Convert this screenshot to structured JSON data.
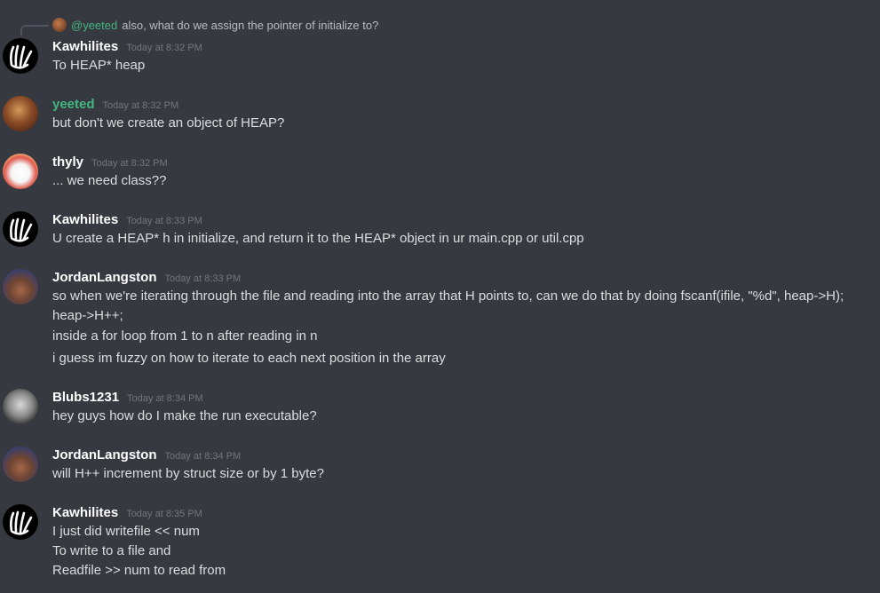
{
  "reply": {
    "name": "@yeeted",
    "text": "also, what do we assign the pointer of initialize to?"
  },
  "messages": [
    {
      "author": "Kawhilites",
      "time": "Today at 8:32 PM",
      "lines": [
        "To HEAP* heap"
      ]
    },
    {
      "author": "yeeted",
      "time": "Today at 8:32 PM",
      "lines": [
        "but don't we create an object of HEAP?"
      ]
    },
    {
      "author": "thyly",
      "time": "Today at 8:32 PM",
      "lines": [
        "... we need class??"
      ]
    },
    {
      "author": "Kawhilites",
      "time": "Today at 8:33 PM",
      "lines": [
        "U create a HEAP* h in initialize, and return it to the HEAP* object in ur main.cpp or util.cpp"
      ]
    },
    {
      "author": "JordanLangston",
      "time": "Today at 8:33 PM",
      "lines": [
        "so when we're iterating through the file and reading into the array that H points to, can we do that by doing fscanf(ifile, \"%d\", heap->H);",
        "heap->H++;",
        "inside a for loop from 1 to n after reading in n",
        "i guess im fuzzy on how to iterate to each next position in the array"
      ]
    },
    {
      "author": "Blubs1231",
      "time": "Today at 8:34 PM",
      "lines": [
        "hey guys how do I make the run executable?"
      ]
    },
    {
      "author": "JordanLangston",
      "time": "Today at 8:34 PM",
      "lines": [
        "will H++ increment by struct size or by 1 byte?"
      ]
    },
    {
      "author": "Kawhilites",
      "time": "Today at 8:35 PM",
      "lines": [
        "I just did writefile << num",
        "To write to a file and",
        "Readfile >> num to read from"
      ]
    }
  ]
}
